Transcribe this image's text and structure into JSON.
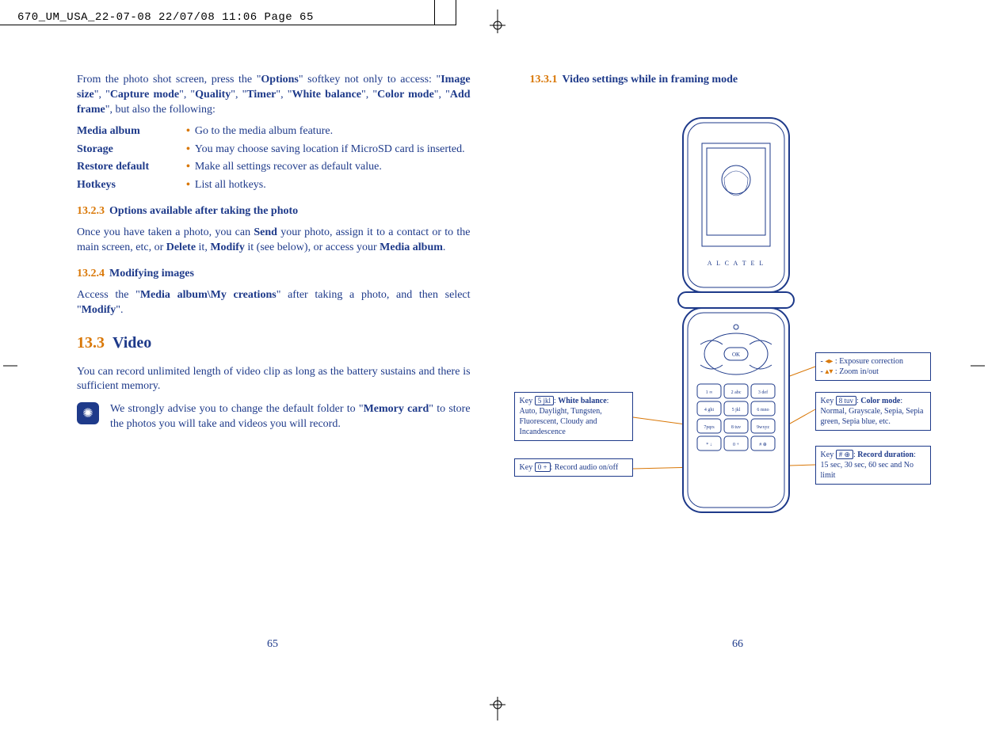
{
  "header": "670_UM_USA_22-07-08  22/07/08  11:06  Page 65",
  "left": {
    "intro_1a": "From the photo shot screen, press the \"",
    "intro_1b": "Options",
    "intro_1c": "\" softkey not only to access: \"",
    "intro_1d": "Image size",
    "intro_1e": "\", \"",
    "intro_1f": "Capture mode",
    "intro_1g": "\", \"",
    "intro_1h": "Quality",
    "intro_1i": "\", \"",
    "intro_1j": "Timer",
    "intro_1k": "\", \"",
    "intro_1l": "White balance",
    "intro_1m": "\", \"",
    "intro_1n": "Color mode",
    "intro_1o": "\", \"",
    "intro_1p": "Add frame",
    "intro_1q": "\", but also the following:",
    "rows": [
      {
        "k": "Media album",
        "v": "Go to the media album feature."
      },
      {
        "k": "Storage",
        "v": "You may choose saving location if MicroSD card is inserted."
      },
      {
        "k": "Restore default",
        "v": "Make all settings recover as default value."
      },
      {
        "k": "Hotkeys",
        "v": "List all hotkeys."
      }
    ],
    "s1_num": "13.2.3",
    "s1_t": "Options available after taking the photo",
    "p1a": "Once you have taken a photo, you can ",
    "p1b": "Send",
    "p1c": " your photo, assign it to a contact or to the main screen, etc, or ",
    "p1d": "Delete",
    "p1e": " it, ",
    "p1f": "Modify",
    "p1g": " it (see below), or access your ",
    "p1h": "Media album",
    "p1i": ".",
    "s2_num": "13.2.4",
    "s2_t": "Modifying images",
    "p2a": "Access the \"",
    "p2b": "Media album\\My creations",
    "p2c": "\" after taking a photo, and then select \"",
    "p2d": "Modify",
    "p2e": "\".",
    "sec_num": "13.3",
    "sec_t": "Video",
    "p3": "You can record unlimited length of video clip as long as the battery sustains and there is sufficient memory.",
    "tip_a": "We strongly advise you to change the default folder to \"",
    "tip_b": "Memory card",
    "tip_c": "\" to store the photos you will take and videos you will record.",
    "page": "65"
  },
  "right": {
    "s_num": "13.3.1",
    "s_t": "Video settings while in framing mode",
    "callouts": {
      "c1_a": "Key ",
      "c1_key": "5 jkl",
      "c1_b": ": ",
      "c1_bold": "White balance",
      "c1_c": ": Auto, Daylight, Tungsten, Fluorescent, Cloudy and Incandescence",
      "c2_a": "Key ",
      "c2_key": "0 +",
      "c2_b": ": Record audio on/off",
      "c3_a": "- ",
      "c3_b": " : Exposure correction",
      "c3_c": "- ",
      "c3_d": " : Zoom in/out",
      "c4_a": "Key ",
      "c4_key": "8 tuv",
      "c4_b": ": ",
      "c4_bold": "Color mode",
      "c4_c": ": Normal, Grayscale, Sepia, Sepia green, Sepia blue, etc.",
      "c5_a": "Key ",
      "c5_key": "# ⊕",
      "c5_b": ": ",
      "c5_bold": "Record duration",
      "c5_c": ": 15 sec, 30 sec, 60 sec and No limit"
    },
    "phone_brand": "A L C A T E L",
    "page": "66"
  }
}
